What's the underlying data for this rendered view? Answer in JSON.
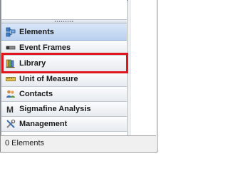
{
  "navigator": {
    "items": [
      {
        "label": "Elements",
        "icon": "elements-icon",
        "state": "selected"
      },
      {
        "label": "Event Frames",
        "icon": "event-frames-icon",
        "state": "normal"
      },
      {
        "label": "Library",
        "icon": "library-icon",
        "state": "highlighted"
      },
      {
        "label": "Unit of Measure",
        "icon": "unit-of-measure-icon",
        "state": "normal"
      },
      {
        "label": "Contacts",
        "icon": "contacts-icon",
        "state": "normal"
      },
      {
        "label": "Sigmafine Analysis",
        "icon": "sigmafine-icon",
        "state": "normal"
      },
      {
        "label": "Management",
        "icon": "management-icon",
        "state": "normal"
      }
    ]
  },
  "status_bar": {
    "text": "0 Elements"
  },
  "colors": {
    "selected_bg": "#c7daf4",
    "highlight_box": "#e0161e"
  }
}
